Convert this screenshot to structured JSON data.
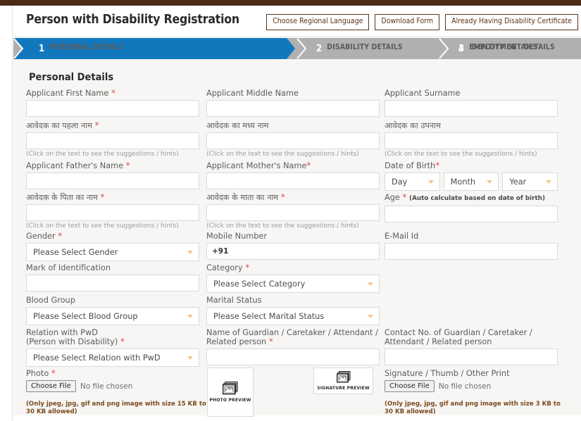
{
  "header": {
    "title": "Person with Disability Registration",
    "buttons": [
      {
        "label": "Choose Regional Language",
        "name": "choose-regional-language-button"
      },
      {
        "label": "Download Form",
        "name": "download-form-button"
      },
      {
        "label": "Already Having Disability Certificate",
        "name": "already-having-disability-certificate-button"
      }
    ]
  },
  "steps": [
    {
      "num": "1",
      "label": "PERSONAL DETAILS",
      "active": true
    },
    {
      "num": "2",
      "label": "DISABILITY DETAILS",
      "active": false
    },
    {
      "num": "3",
      "label": "EMPLOYMENT DETAILS",
      "active": false
    },
    {
      "num": "4",
      "label": "IDENTITY DETAILS",
      "active": false
    }
  ],
  "colors": {
    "active_step": "#1278be",
    "inactive_step": "#b0b0b0",
    "top_strip": "#4a2c16",
    "button_border": "#5a3418",
    "required_star": "#d9534f",
    "form_background": "#f7f6f4",
    "chevron": "#f0c98a",
    "note_text": "#7a4a1e"
  },
  "form": {
    "section_title": "Personal Details",
    "suggestion_hint": "(Click on the text to see the suggestions / hints)",
    "fields": {
      "first_name_en": {
        "label": "Applicant First Name",
        "required": true,
        "value": ""
      },
      "middle_name_en": {
        "label": "Applicant Middle Name",
        "required": false,
        "value": ""
      },
      "surname_en": {
        "label": "Applicant Surname",
        "required": false,
        "value": ""
      },
      "first_name_hi": {
        "label": "आवेदक का पहला नाम",
        "required": true,
        "value": ""
      },
      "middle_name_hi": {
        "label": "आवेदक का मध्य नाम",
        "required": false,
        "value": ""
      },
      "surname_hi": {
        "label": "आवेदक का उपनाम",
        "required": false,
        "value": ""
      },
      "father_name_en": {
        "label": "Applicant Father's Name",
        "required": true,
        "value": ""
      },
      "mother_name_en": {
        "label": "Applicant Mother's Name",
        "required": true,
        "value": ""
      },
      "father_name_hi": {
        "label": "आवेदक के पिता का नाम",
        "required": true,
        "value": ""
      },
      "mother_name_hi": {
        "label": "आवेदक के माता का नाम",
        "required": true,
        "value": ""
      },
      "dob": {
        "label": "Date of Birth",
        "required": true,
        "day": "Day",
        "month": "Month",
        "year": "Year"
      },
      "age": {
        "label": "Age",
        "required": true,
        "note": "(Auto calculate based on date of birth)",
        "value": ""
      },
      "gender": {
        "label": "Gender",
        "required": true,
        "value": "Please Select Gender"
      },
      "mobile": {
        "label": "Mobile Number",
        "required": false,
        "value": "+91"
      },
      "email": {
        "label": "E-Mail Id",
        "required": false,
        "value": ""
      },
      "mark_of_identification": {
        "label": "Mark of Identification",
        "required": false,
        "value": ""
      },
      "category": {
        "label": "Category",
        "required": true,
        "value": "Please Select Category"
      },
      "blood_group": {
        "label": "Blood Group",
        "required": false,
        "value": "Please Select Blood Group"
      },
      "marital_status": {
        "label": "Marital Status",
        "required": false,
        "value": "Please Select Marital Status"
      },
      "relation_with_pwd": {
        "label_line1": "Relation with PwD",
        "label_line2": "(Person with Disability)",
        "required": true,
        "value": "Please Select Relation with PwD"
      },
      "guardian_name": {
        "label": "Name of Guardian / Caretaker / Attendant / Related person",
        "required": true,
        "value": ""
      },
      "guardian_contact": {
        "label": "Contact No. of Guardian / Caretaker / Attendant / Related person",
        "required": false,
        "value": ""
      },
      "photo": {
        "label": "Photo",
        "required": true,
        "button": "Choose File",
        "status": "No file chosen",
        "note": "(Only jpeg, jpg, gif and png image with size 15 KB to 30 KB allowed)",
        "preview_caption": "PHOTO PREVIEW"
      },
      "signature": {
        "label": "Signature / Thumb / Other Print",
        "required": false,
        "button": "Choose File",
        "status": "No file chosen",
        "note": "(Only jpeg, jpg, gif and png image with size 3 KB to 30 KB allowed)",
        "preview_caption": "SIGNATURE PREVIEW"
      }
    }
  }
}
